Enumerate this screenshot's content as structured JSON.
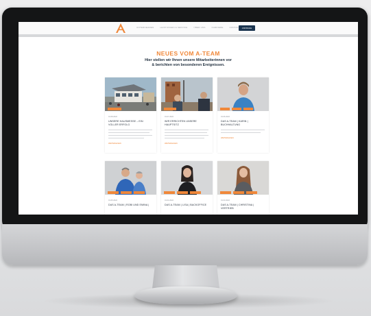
{
  "nav": {
    "links": [
      "UNTERNEHMEN",
      "LEISTUNGEN & SERVICE",
      "ÜBER UNS",
      "KARRIERE",
      "KONTAKT"
    ],
    "cta": "ANFRAGE"
  },
  "hero": {
    "title": "NEUES VOM A-TEAM",
    "subtitle_line1": "Hier stellen wir Ihnen unsere Mitarbeiterinnen vor",
    "subtitle_line2": "& berichten von besonderen Ereignissen."
  },
  "posts": [
    {
      "date": "01.08.2022",
      "title": "UNSERE HAUSMESSE – EIN VOLLER ERFOLG",
      "more": "WEITERLESEN"
    },
    {
      "date": "01.07.2022",
      "title": "WIR ERRICHTEN UNSERE HAUPTSITZ",
      "more": "WEITERLESEN"
    },
    {
      "date": "01.06.2022",
      "title": "DAS A-TEAM | KARIN | BUCHHALTUNG",
      "more": "WEITERLESEN"
    },
    {
      "date": "01.05.2022",
      "title": "DAS A-TEAM | ROBI UND EMINA |",
      "more": ""
    },
    {
      "date": "01.04.2022",
      "title": "DAS A-TEAM | LISA | BACKOFFICE",
      "more": ""
    },
    {
      "date": "01.03.2022",
      "title": "DAS A-TEAM | CHRISTINA | VERTRIEB",
      "more": ""
    }
  ],
  "colors": {
    "accent": "#f0883a",
    "navy": "#1b3550",
    "bezel": "#141516"
  }
}
